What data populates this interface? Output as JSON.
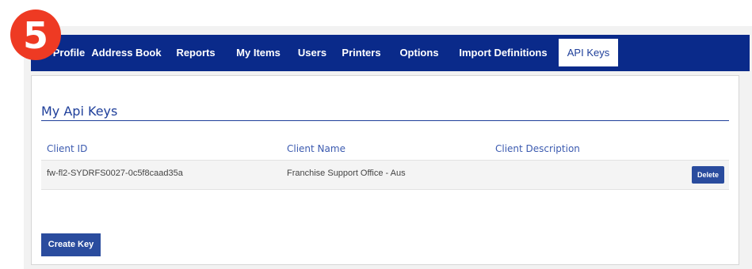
{
  "step_badge": "5",
  "nav": {
    "tabs": [
      {
        "label": "Profile",
        "active": false
      },
      {
        "label": "Address Book",
        "active": false
      },
      {
        "label": "Reports",
        "active": false
      },
      {
        "label": "My Items",
        "active": false
      },
      {
        "label": "Users",
        "active": false
      },
      {
        "label": "Printers",
        "active": false
      },
      {
        "label": "Options",
        "active": false
      },
      {
        "label": "Import Definitions",
        "active": false
      },
      {
        "label": "API Keys",
        "active": true
      }
    ]
  },
  "section": {
    "title": "My Api Keys"
  },
  "table": {
    "columns": [
      "Client ID",
      "Client Name",
      "Client Description"
    ],
    "rows": [
      {
        "client_id": "fw-fl2-SYDRFS0027-0c5f8caad35a",
        "client_name": "Franchise Support Office - Aus",
        "client_description": "",
        "action_label": "Delete"
      }
    ]
  },
  "actions": {
    "create_key_label": "Create Key"
  },
  "colors": {
    "nav_background": "#0a2a8a",
    "accent": "#1f3f9a",
    "button": "#2a4c9e",
    "badge": "#ee3a23"
  }
}
